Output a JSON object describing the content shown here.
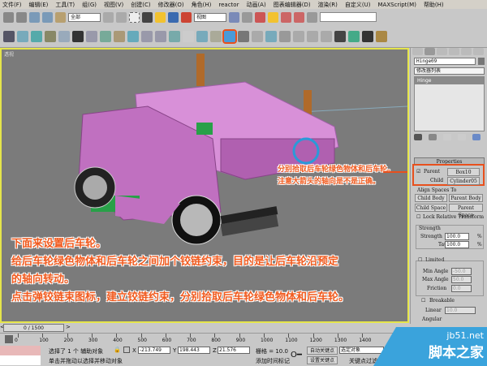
{
  "menu": [
    "文件(F)",
    "编辑(E)",
    "工具(T)",
    "组(G)",
    "视图(V)",
    "创建(C)",
    "修改器(O)",
    "角色(H)",
    "reactor",
    "动画(A)",
    "图表编辑器(D)",
    "渲染(R)",
    "自定义(U)",
    "MAXScript(M)",
    "帮助(H)"
  ],
  "toolbar": {
    "selection_filter": "全部",
    "ref_coord": "视图"
  },
  "viewport": {
    "label": "透视"
  },
  "notes": {
    "side": [
      "分别拾取后车轮绿色物体和后车轮。",
      "注意大箭头的轴向是不是正确。"
    ],
    "main": [
      "下面来设置后车轮。",
      "给后车轮绿色物体和后车轮之间加个铰链约束，目的是让后车轮沿预定",
      "的轴向转动。",
      "点击弹铰链束图标，建立铰链约束，分别拾取后车轮绿色物体和后车轮。"
    ]
  },
  "panel": {
    "object_name": "Hinge09",
    "modifier_list": "修改器列表",
    "stack_item": "Hinge",
    "properties_title": "Properties",
    "parent_label": "Parent",
    "parent_value": "Box10",
    "child_label": "Child",
    "child_value": "Cylinder05",
    "align_title": "Align Spaces To",
    "child_body": "Child Body",
    "parent_body": "Parent Body",
    "child_space": "Child Space",
    "parent_space": "Parent Space",
    "lock_relative": "Lock Relative Transform",
    "strength_title": "Strength",
    "strength_label": "Strength",
    "strength_value": "100.0",
    "tau_label": "Tau",
    "tau_value": "100.0",
    "pct": "%",
    "limited": "Limited",
    "min_angle_label": "Min Angle",
    "min_angle": "-50.0",
    "max_angle_label": "Max Angle",
    "max_angle": "50.0",
    "friction_label": "Friction",
    "friction": "0.0",
    "breakable": "Breakable",
    "linear_label": "Linear",
    "linear": "10.0",
    "angular_label": "Angular"
  },
  "timeline": {
    "frame": "0 / 1500",
    "ticks": [
      "0",
      "100",
      "200",
      "300",
      "400",
      "500",
      "600",
      "700",
      "800",
      "900",
      "1000",
      "1100",
      "1200",
      "1300",
      "1400"
    ]
  },
  "status": {
    "selected": "选择了 1 个 辅助对象",
    "x": "-213.749",
    "y": "198.443",
    "z": "21.576",
    "grid": "栅格 = 10.0",
    "prompt": "单击并拖动以选择并移动对象",
    "add_time_tag": "添加时间标记",
    "auto_key": "自动关键点",
    "set_key": "设置关键点",
    "key_filter_sel": "选定对象",
    "key_filters": "关键点过滤器..."
  },
  "watermark": {
    "url": "jb51.net",
    "name": "脚本之家"
  }
}
